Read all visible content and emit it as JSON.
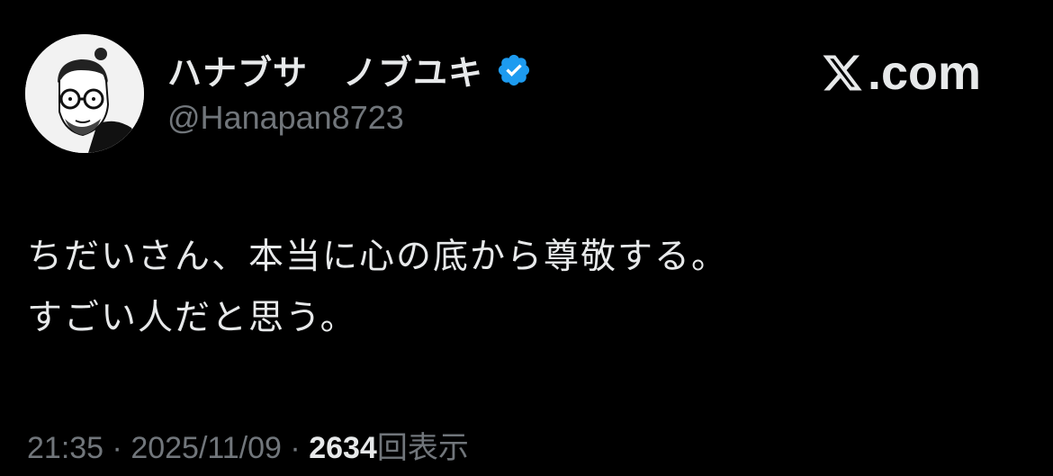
{
  "author": {
    "display_name": "ハナブサ　ノブユキ",
    "handle": "@Hanapan8723",
    "verified": true,
    "avatar": "avatar-illustration"
  },
  "brand": {
    "text": ".com",
    "logo_icon": "x-logo-icon"
  },
  "tweet": {
    "text": "ちだいさん、本当に心の底から尊敬する。\nすごい人だと思う。"
  },
  "meta": {
    "time": "21:35",
    "separator": " · ",
    "date": "2025/11/09",
    "views": "2634",
    "views_label": "回表示"
  },
  "colors": {
    "background": "#000000",
    "text_primary": "#e7e9ea",
    "text_secondary": "#71767b",
    "verified_badge": "#1d9bf0"
  }
}
